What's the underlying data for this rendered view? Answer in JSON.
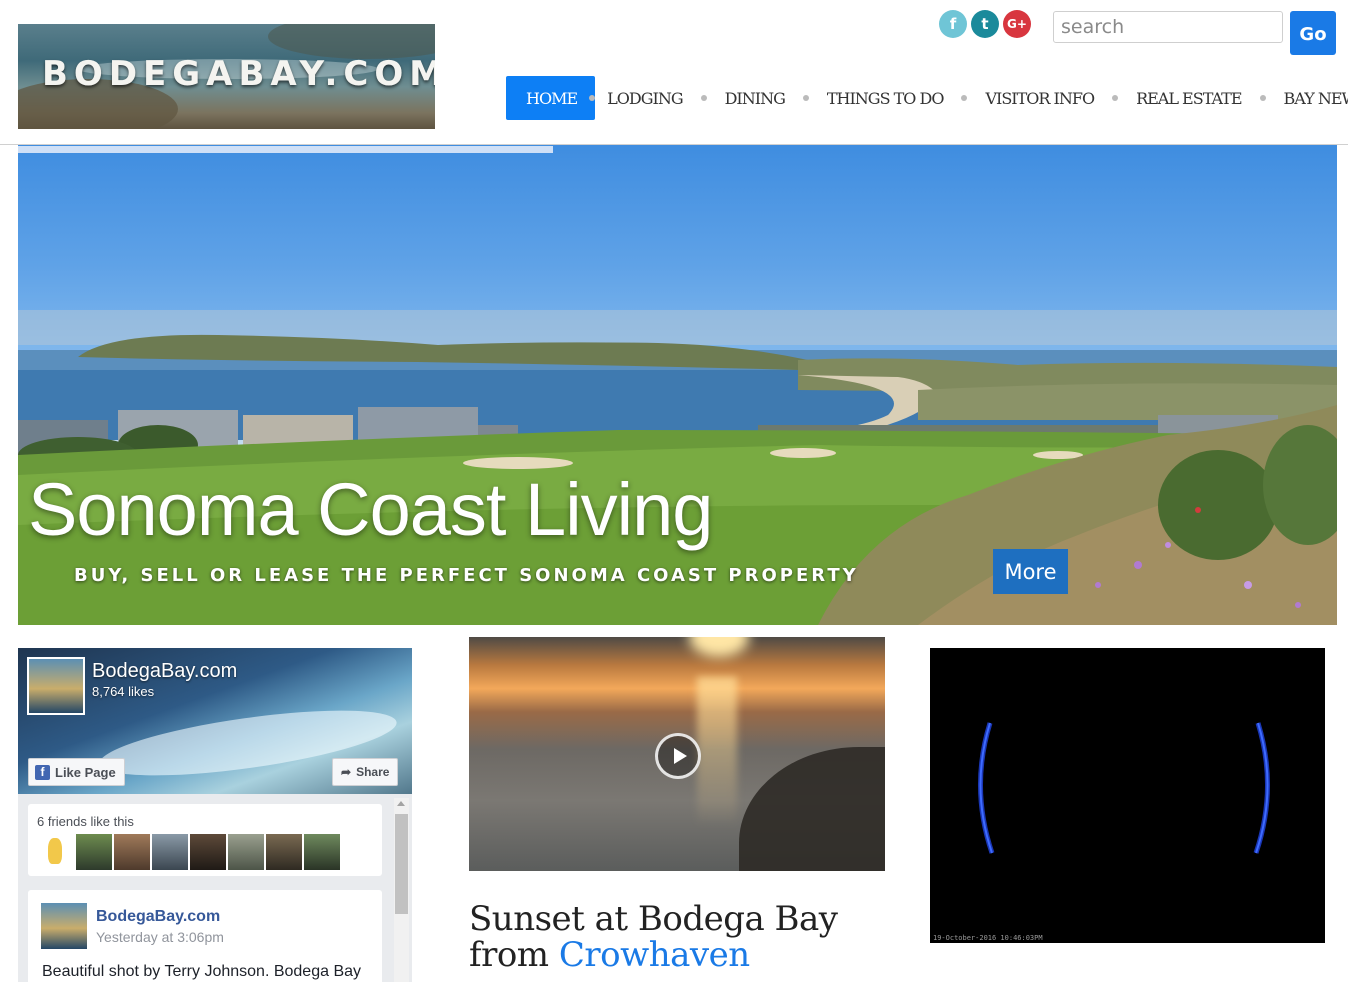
{
  "header": {
    "logo_text": "BODEGABAY.COM",
    "social": [
      {
        "icon": "facebook-icon",
        "glyph": "f"
      },
      {
        "icon": "twitter-icon",
        "glyph": "t"
      },
      {
        "icon": "google-plus-icon",
        "glyph": "G+"
      }
    ],
    "search_placeholder": "search",
    "search_value": "",
    "go_label": "Go"
  },
  "nav": {
    "items": [
      "HOME",
      "LODGING",
      "DINING",
      "THINGS TO DO",
      "VISITOR INFO",
      "REAL ESTATE",
      "BAY NEWS"
    ],
    "active": "HOME"
  },
  "hero": {
    "title": "Sonoma Coast Living",
    "subtitle": "BUY, SELL OR LEASE THE PERFECT SONOMA COAST PROPERTY",
    "more_label": "More"
  },
  "facebook": {
    "page_name": "BodegaBay.com",
    "likes": "8,764 likes",
    "like_label": "Like Page",
    "share_label": "Share",
    "friends_text": "6 friends like this",
    "post_author": "BodegaBay.com",
    "post_time": "Yesterday at 3:06pm",
    "post_text": "Beautiful shot by Terry Johnson. Bodega Bay"
  },
  "video_post": {
    "title_part1": "Sunset at Bodega Bay from ",
    "title_link": "Crowhaven"
  },
  "webcam": {
    "timestamp": "19-October-2016 10:46:03PM"
  },
  "colors": {
    "accent": "#1a7ae6",
    "nav_active": "#0d7ff5",
    "more_button": "#1e6fc0",
    "facebook_name": "#365899"
  }
}
